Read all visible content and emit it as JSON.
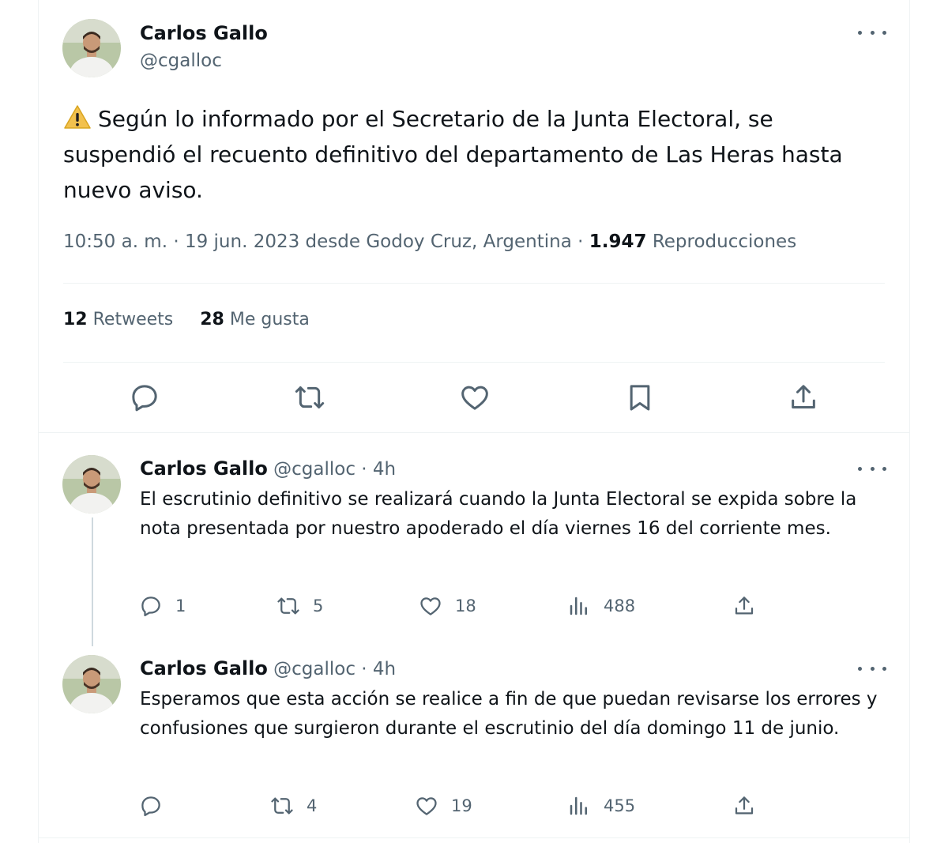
{
  "main_tweet": {
    "author_name": "Carlos Gallo",
    "author_handle": "@cgalloc",
    "text": "Según lo informado por el Secretario de la Junta Electoral, se suspendió el recuento definitivo del departamento de Las Heras hasta nuevo aviso.",
    "time": "10:50 a. m. · 19 jun. 2023 desde Godoy Cruz, Argentina · ",
    "views_count": "1.947",
    "views_label": " Reproducciones",
    "retweets_count": "12",
    "retweets_label": " Retweets",
    "likes_count": "28",
    "likes_label": " Me gusta"
  },
  "replies": [
    {
      "author_name": "Carlos Gallo",
      "author_handle": "@cgalloc · 4h",
      "text": "El escrutinio definitivo se realizará cuando la Junta Electoral se expida sobre la nota presentada por nuestro apoderado el día viernes 16 del corriente mes.",
      "replies": "1",
      "retweets": "5",
      "likes": "18",
      "views": "488"
    },
    {
      "author_name": "Carlos Gallo",
      "author_handle": "@cgalloc · 4h",
      "text": "Esperamos que esta acción se realice a fin de que puedan revisarse los errores y confusiones que surgieron durante el escrutinio del día domingo 11 de junio.",
      "replies": "",
      "retweets": "4",
      "likes": "19",
      "views": "455"
    }
  ],
  "icons": {
    "warning": "warning-icon",
    "more": "more-icon",
    "reply": "reply-icon",
    "retweet": "retweet-icon",
    "like": "heart-icon",
    "bookmark": "bookmark-icon",
    "share": "share-icon",
    "views": "views-icon"
  },
  "colors": {
    "text": "#0f1419",
    "secondary": "#536471",
    "divider": "#eff3f4",
    "thread_line": "#cfd9de",
    "warning": "#f2c14e"
  }
}
